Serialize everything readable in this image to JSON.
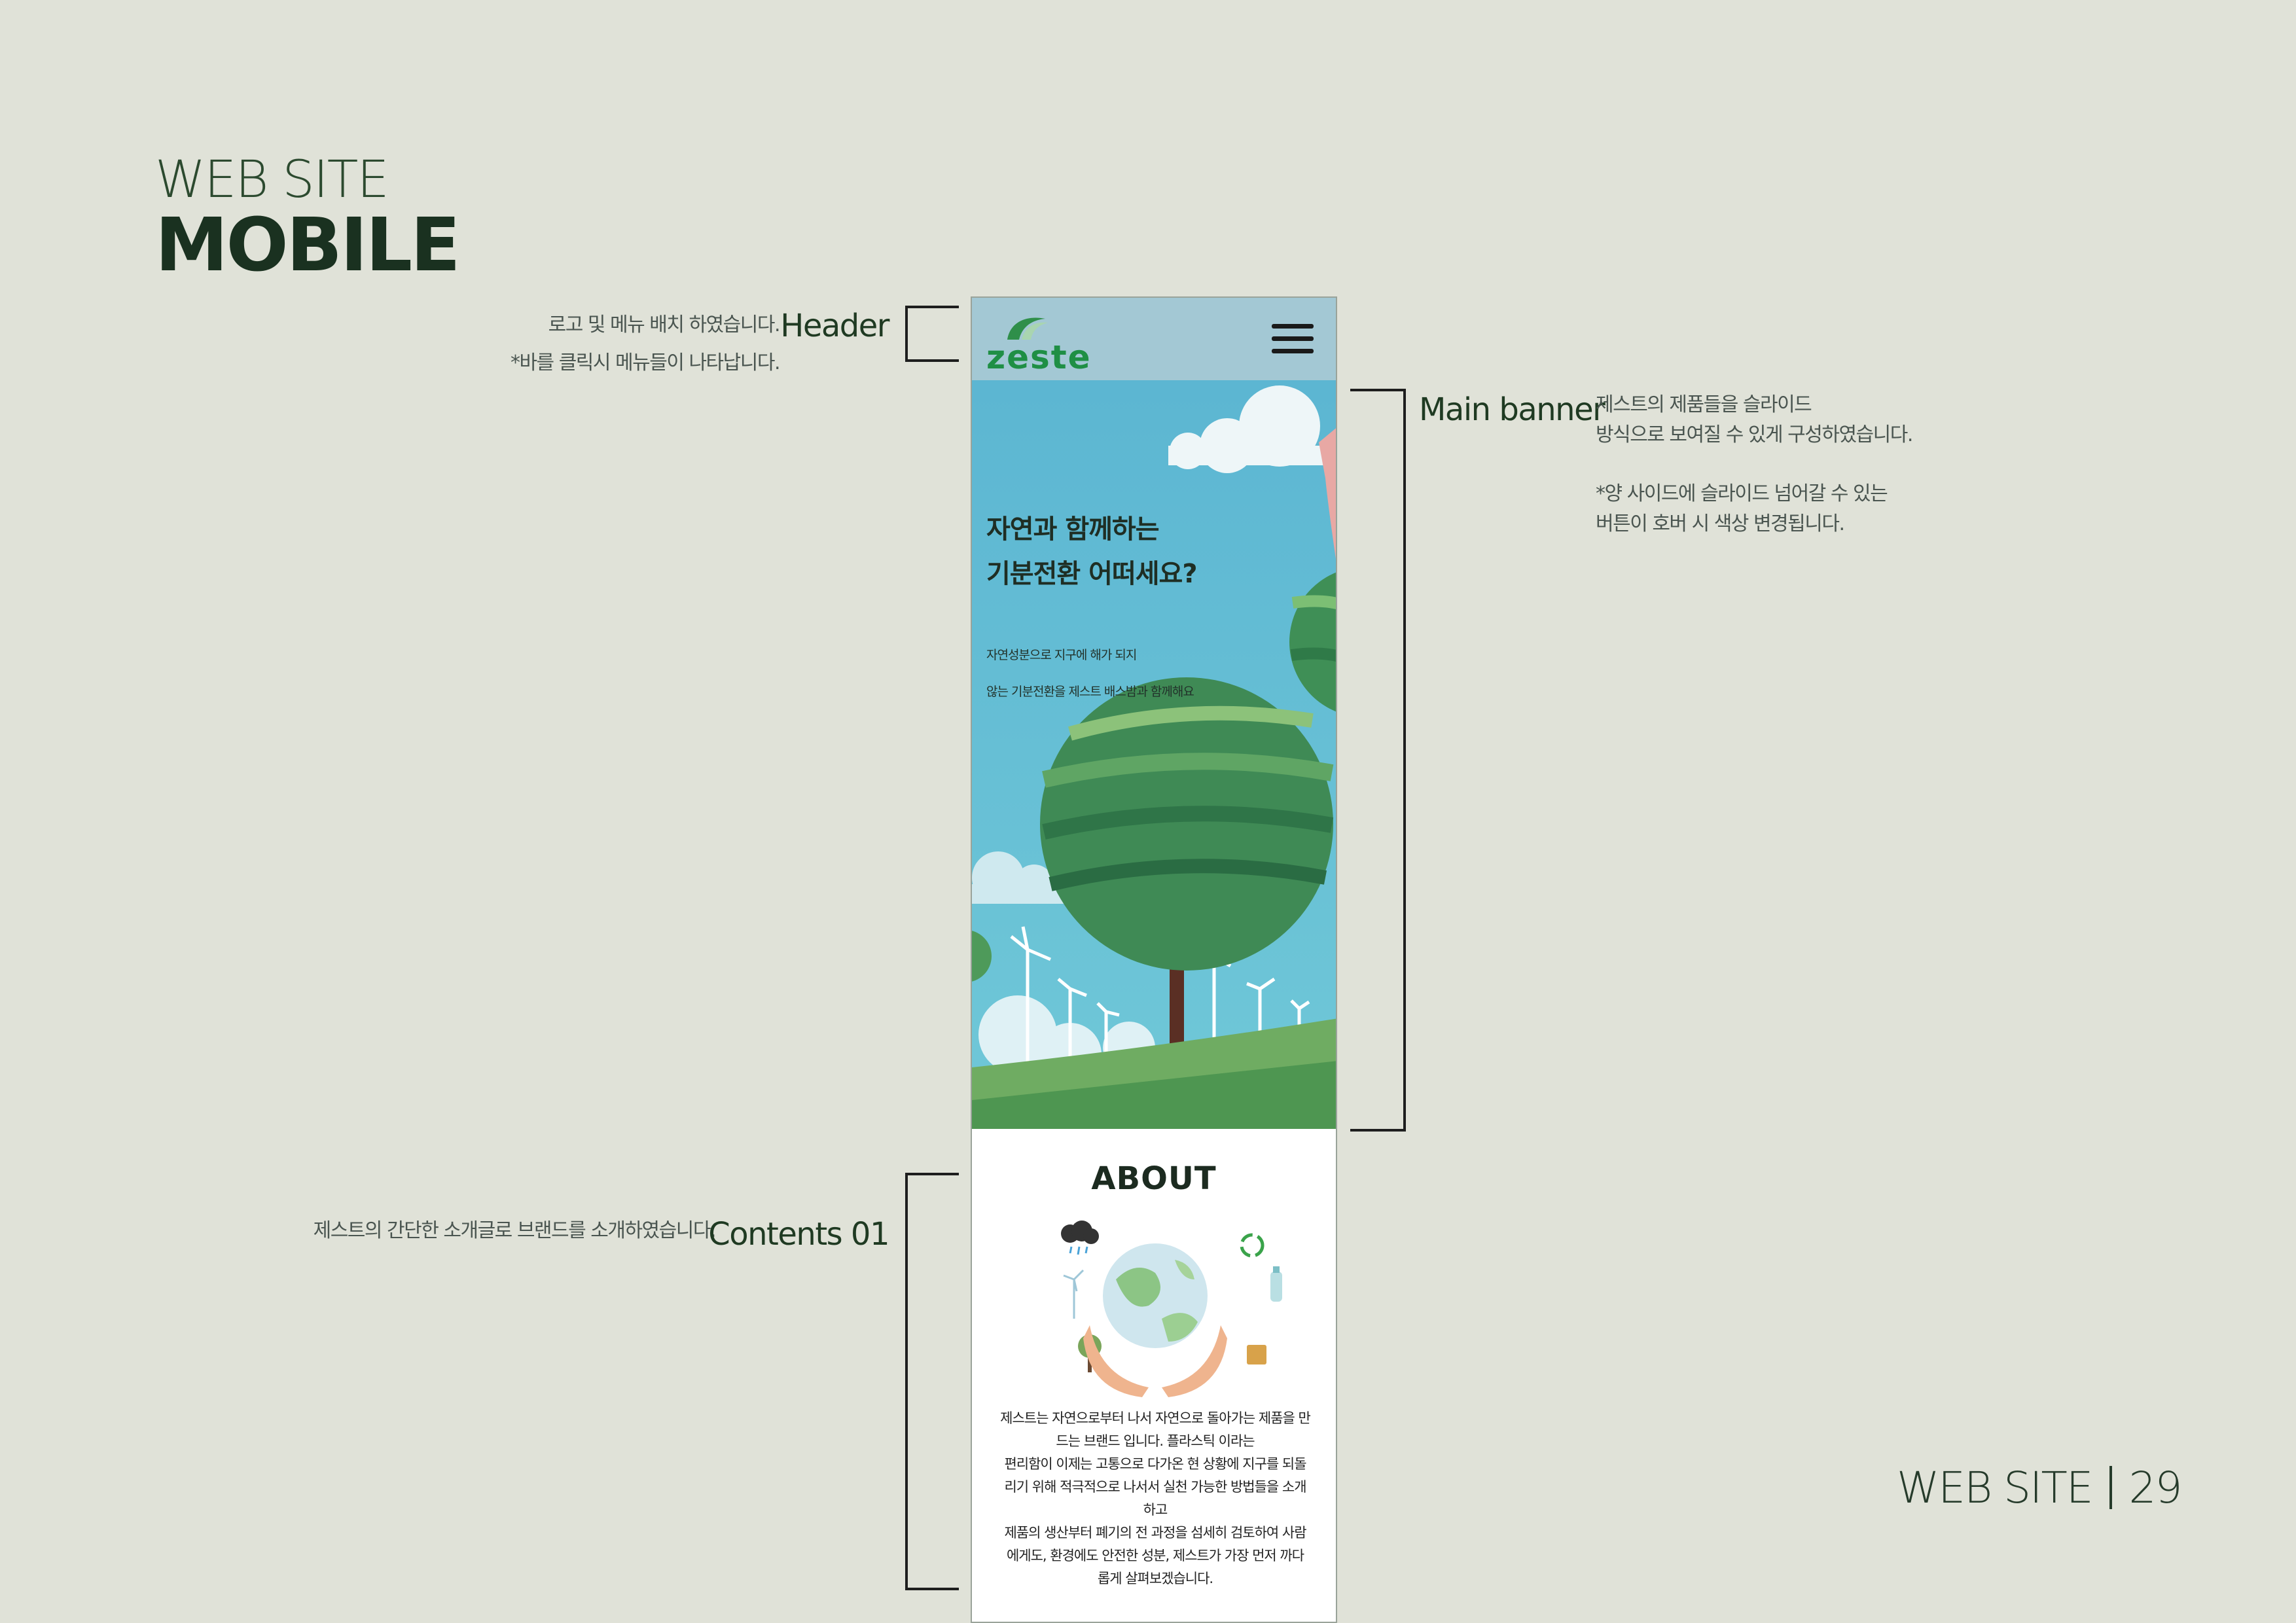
{
  "slide": {
    "kicker": "WEB SITE",
    "title": "MOBILE",
    "footer_section": "WEB SITE",
    "page_number": "29"
  },
  "annotations": {
    "header": {
      "label": "Header",
      "notes": [
        "로고 및 메뉴 배치 하였습니다.",
        "*바를 클릭시 메뉴들이 나타납니다."
      ]
    },
    "banner": {
      "label": "Main banner",
      "notes": [
        "제스트의 제품들을 슬라이드",
        "방식으로 보여질 수 있게 구성하였습니다.",
        "*양 사이드에 슬라이드 넘어갈 수 있는",
        "버튼이 호버 시 색상 변경됩니다."
      ]
    },
    "contents": {
      "label": "Contents 01",
      "notes": [
        "제스트의 간단한 소개글로 브랜드를 소개하였습니다."
      ]
    }
  },
  "mobile": {
    "logo": "zeste",
    "menu_icon": "hamburger-icon",
    "banner": {
      "headline": [
        "자연과 함께하는",
        "기분전환 어떠세요?"
      ],
      "sub": [
        "자연성분으로 지구에 해가 되지",
        "않는 기분전환을 제스트 배스밤과 함께해요"
      ]
    },
    "about": {
      "title": "ABOUT",
      "text": [
        "제스트는 자연으로부터 나서 자연으로 돌아가는 제품을 만",
        "드는 브랜드 입니다. 플라스틱 이라는",
        "편리함이 이제는 고통으로 다가온 현 상황에 지구를 되돌",
        "리기 위해 적극적으로 나서서 실천 가능한 방법들을 소개",
        "하고",
        "제품의 생산부터 폐기의 전 과정을 섬세히 검토하여 사람",
        "에게도, 환경에도 안전한 성분, 제스트가 가장 먼저 까다",
        "롭게 살펴보겠습니다."
      ]
    }
  },
  "colors": {
    "background": "#e0e2d8",
    "brand_green": "#1f8f45",
    "sky": "#5cb6d2",
    "header_blue": "#a3c8d4"
  }
}
